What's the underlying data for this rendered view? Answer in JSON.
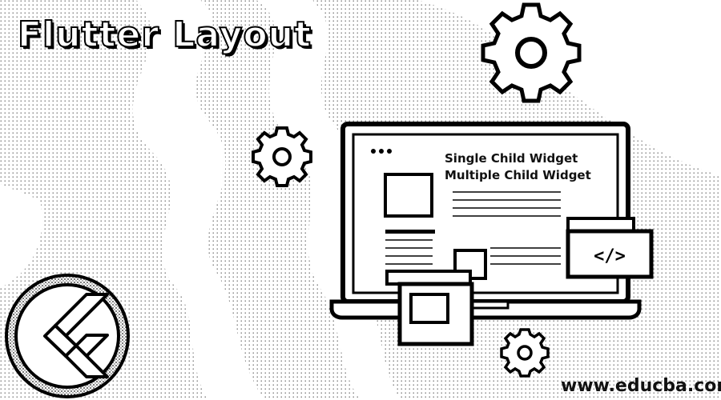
{
  "banner": {
    "title": "Flutter Layout",
    "screen_lines": [
      "Single Child Widget",
      "Multiple Child Widget"
    ],
    "code_badge": "</>",
    "footer_url": "www.educba.com"
  },
  "icons": [
    "gear-icon",
    "flutter-logo-icon",
    "laptop-icon",
    "code-tag-icon"
  ],
  "colors": {
    "background": "#f4f4f4",
    "ink": "#111111",
    "white": "#ffffff"
  }
}
